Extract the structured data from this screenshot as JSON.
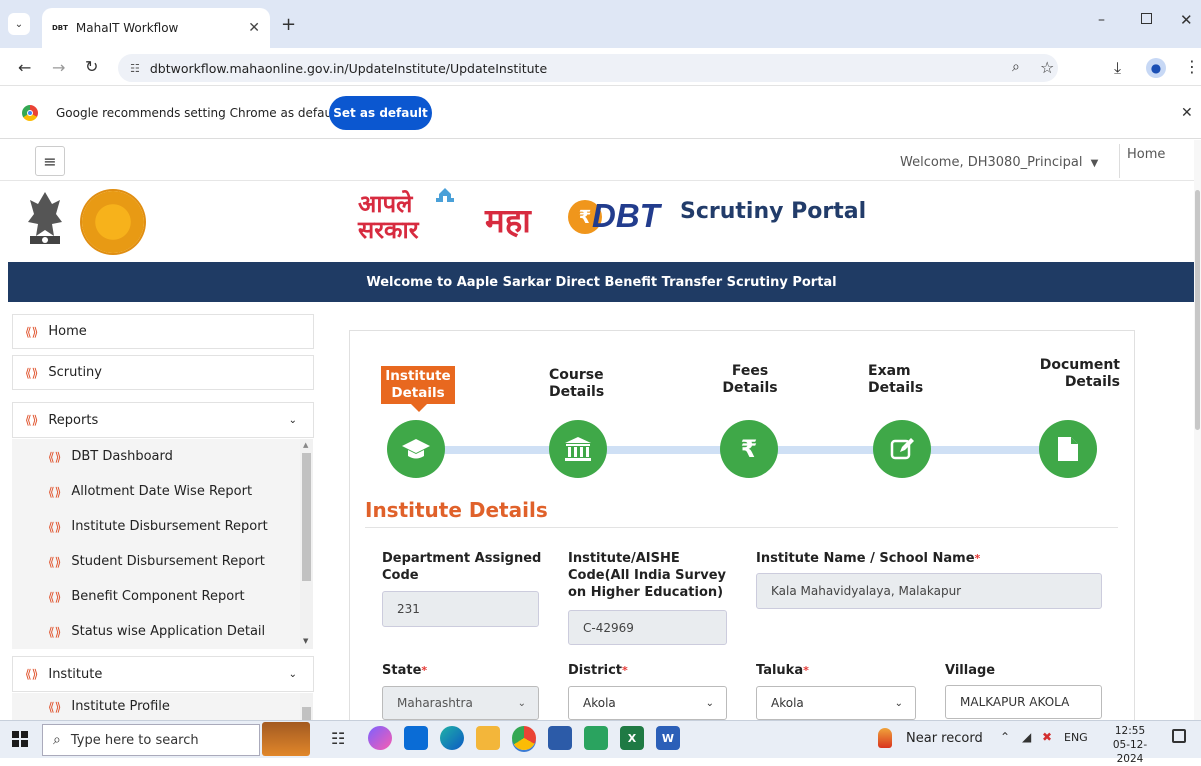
{
  "browser": {
    "tab_title": "MahaIT Workflow",
    "tab_favicon": "DBT",
    "url": "dbtworkflow.mahaonline.gov.in/UpdateInstitute/UpdateInstitute"
  },
  "infobar": {
    "message": "Google recommends setting Chrome as default",
    "button": "Set as default"
  },
  "header": {
    "welcome": "Welcome, DH3080_Principal",
    "home_link": "Home",
    "logo_aaple": "आपले सरकार",
    "logo_maha": "महा",
    "logo_dbt": "DBT",
    "portal_title": "Scrutiny Portal",
    "banner": "Welcome to Aaple Sarkar Direct Benefit Transfer Scrutiny Portal"
  },
  "sidebar": {
    "home": "Home",
    "scrutiny": "Scrutiny",
    "reports": "Reports",
    "reports_items": [
      "DBT Dashboard",
      "Allotment Date Wise Report",
      "Institute Disbursement Report",
      "Student Disbursement Report",
      "Benefit Component Report",
      "Status wise Application Detail"
    ],
    "institute": "Institute",
    "institute_items": [
      "Institute Profile"
    ]
  },
  "steps": {
    "institute": [
      "Institute",
      "Details"
    ],
    "course": [
      "Course",
      "Details"
    ],
    "fees": [
      "Fees",
      "Details"
    ],
    "exam": [
      "Exam",
      "Details"
    ],
    "document": [
      "Document",
      "Details"
    ]
  },
  "form": {
    "section_title": "Institute Details",
    "dept_code_label_1": "Department Assigned",
    "dept_code_label_2": "Code",
    "dept_code_value": "231",
    "aishe_label_1": "Institute/AISHE",
    "aishe_label_2": "Code(All India Survey",
    "aishe_label_3": "on Higher Education)",
    "aishe_value": "C-42969",
    "name_label": "Institute Name / School Name",
    "name_value": "Kala Mahavidyalaya, Malakapur",
    "state_label": "State",
    "state_value": "Maharashtra",
    "district_label": "District",
    "district_value": "Akola",
    "taluka_label": "Taluka",
    "taluka_value": "Akola",
    "village_label": "Village",
    "village_value": "MALKAPUR AKOLA"
  },
  "taskbar": {
    "search_placeholder": "Type here to search",
    "weather": "Near record",
    "lang": "ENG",
    "time": "12:55",
    "date": "05-12-2024"
  },
  "colors": {
    "accent_orange": "#e8681f",
    "step_green": "#3fa848",
    "banner_navy": "#1f3b64",
    "chrome_blue": "#0b57d0"
  }
}
